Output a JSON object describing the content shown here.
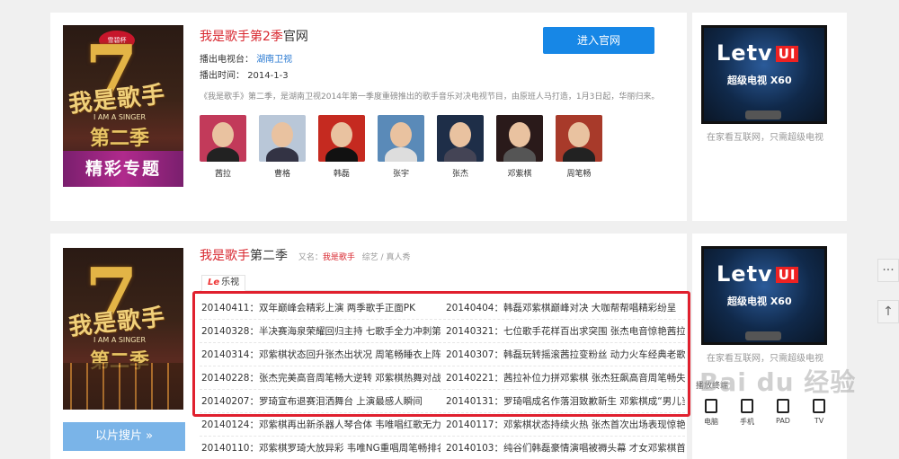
{
  "show1": {
    "poster": {
      "badge": "雪碧杯",
      "seven": "7",
      "logo": "我是歌手",
      "en": "I AM A SINGER",
      "season": "第二季",
      "banner": "精彩专题"
    },
    "title_red": "我是歌手第2季",
    "title_suffix": "官网",
    "station_label": "播出电视台：",
    "station": "湖南卫视",
    "time_label": "播出时间：",
    "time": "2014-1-3",
    "description": "《我是歌手》第二季，是湖南卫视2014年第一季度重磅推出的歌手音乐对决电视节目，由原班人马打造，1月3日起，华丽归来。",
    "enter_button": "进入官网",
    "cast": [
      {
        "name": "茜拉",
        "bg": "#c23a5a",
        "shirt": "#222"
      },
      {
        "name": "曹格",
        "bg": "#b9c7d8",
        "shirt": "#334"
      },
      {
        "name": "韩磊",
        "bg": "#c52a20",
        "shirt": "#111"
      },
      {
        "name": "张宇",
        "bg": "#5a8ab8",
        "shirt": "#ddd"
      },
      {
        "name": "张杰",
        "bg": "#1e2e48",
        "shirt": "#445"
      },
      {
        "name": "邓紫棋",
        "bg": "#2a1a1a",
        "shirt": "#555"
      },
      {
        "name": "周笔畅",
        "bg": "#a83a2a",
        "shirt": "#222"
      }
    ]
  },
  "show2": {
    "poster": {
      "seven": "7",
      "logo": "我是歌手",
      "en": "I AM A SINGER",
      "season": "第二季"
    },
    "title_red": "我是歌手",
    "title_dark": "第二季",
    "alias_label": "又名：",
    "alias": "我是歌手",
    "genre": "综艺 / 真人秀",
    "tab_prefix": "Le",
    "tab_label": "乐视",
    "search_button": "以片搜片",
    "search_chevron": "chevron-double-down-icon",
    "episodes": [
      [
        "20140411：双年巅峰会精彩上演 两季歌手正面PK",
        "20140404：韩磊邓紫棋巅峰对决 大咖帮帮唱精彩纷呈"
      ],
      [
        "20140328：半决赛海泉荣耀回归主持 七歌手全力冲刺第一名",
        "20140321：七位歌手花样百出求突围 张杰电音惊艳茜拉"
      ],
      [
        "20140314：邓紫棋状态回升张杰出状况 周笔畅睡衣上阵",
        "20140307：韩磊玩转摇滚茜拉变粉丝 动力火车经典老歌"
      ],
      [
        "20140228：张杰完美高音周笔畅大逆转 邓紫棋热舞对战",
        "20140221：茜拉补位力拼邓紫棋 张杰狂飙高音周笔畅失手"
      ],
      [
        "20140207：罗琦宣布退赛泪洒舞台 上演最感人瞬间",
        "20140131：罗琦唱成名作落泪致歉新生 邓紫棋成“男儿当自强”"
      ],
      [
        "20140124：邓紫棋再出新杀器人琴合体 韦唯唱红歌无力回天",
        "20140117：邓紫棋状态持续火热 张杰首次出场表现惊艳"
      ],
      [
        "20140110：邓紫棋罗琦大放异彩 韦唯NG重唱周笔畅排名",
        "20140103：纯谷们韩磊豪情演唱被褥头幕 才女邓紫棋首战"
      ]
    ]
  },
  "ad": {
    "brand": "Letv",
    "brand_tag": "UI",
    "model": "超级电视 X60",
    "slogan": "在家看互联网，只需超级电视",
    "device_label": "播放终端",
    "devices": [
      "电脑",
      "手机",
      "PAD",
      "TV"
    ]
  },
  "floating": {
    "chat_icon": "chat-icon",
    "chat": "···",
    "top_icon": "back-to-top-icon",
    "top": "↑"
  },
  "watermark": "Bai du 经验"
}
